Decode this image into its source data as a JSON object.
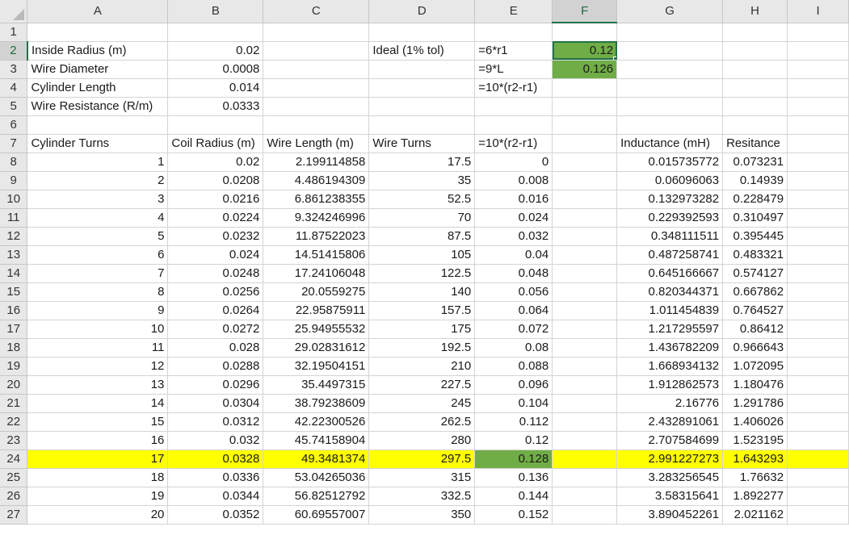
{
  "columns": [
    "A",
    "B",
    "C",
    "D",
    "E",
    "F",
    "G",
    "H",
    "I"
  ],
  "active_cell": "F2",
  "colors": {
    "highlight_row": "#ffff00",
    "green_fill": "#70ad47",
    "selection": "#217346",
    "header_bg": "#e8e8e8"
  },
  "rows": [
    {
      "n": "1",
      "A": "",
      "B": "",
      "C": "",
      "D": "",
      "E": "",
      "F": "",
      "G": "",
      "H": ""
    },
    {
      "n": "2",
      "A": "Inside Radius (m)",
      "B": "0.02",
      "C": "",
      "D": "Ideal (1% tol)",
      "E": "=6*r1",
      "F": "0.12",
      "G": "",
      "H": ""
    },
    {
      "n": "3",
      "A": "Wire Diameter",
      "B": "0.0008",
      "C": "",
      "D": "",
      "E": "=9*L",
      "F": "0.126",
      "G": "",
      "H": ""
    },
    {
      "n": "4",
      "A": "Cylinder Length",
      "B": "0.014",
      "C": "",
      "D": "",
      "E": "=10*(r2-r1)",
      "F": "",
      "G": "",
      "H": ""
    },
    {
      "n": "5",
      "A": "Wire Resistance (R/m)",
      "B": "0.0333",
      "C": "",
      "D": "",
      "E": "",
      "F": "",
      "G": "",
      "H": ""
    },
    {
      "n": "6",
      "A": "",
      "B": "",
      "C": "",
      "D": "",
      "E": "",
      "F": "",
      "G": "",
      "H": ""
    },
    {
      "n": "7",
      "A": "Cylinder Turns",
      "B": "Coil Radius (m)",
      "C": "Wire Length (m)",
      "D": "Wire Turns",
      "E": "=10*(r2-r1)",
      "F": "",
      "G": "Inductance (mH)",
      "H": "Resitance"
    },
    {
      "n": "8",
      "A": "1",
      "B": "0.02",
      "C": "2.199114858",
      "D": "17.5",
      "E": "0",
      "F": "",
      "G": "0.015735772",
      "H": "0.073231"
    },
    {
      "n": "9",
      "A": "2",
      "B": "0.0208",
      "C": "4.486194309",
      "D": "35",
      "E": "0.008",
      "F": "",
      "G": "0.06096063",
      "H": "0.14939"
    },
    {
      "n": "10",
      "A": "3",
      "B": "0.0216",
      "C": "6.861238355",
      "D": "52.5",
      "E": "0.016",
      "F": "",
      "G": "0.132973282",
      "H": "0.228479"
    },
    {
      "n": "11",
      "A": "4",
      "B": "0.0224",
      "C": "9.324246996",
      "D": "70",
      "E": "0.024",
      "F": "",
      "G": "0.229392593",
      "H": "0.310497"
    },
    {
      "n": "12",
      "A": "5",
      "B": "0.0232",
      "C": "11.87522023",
      "D": "87.5",
      "E": "0.032",
      "F": "",
      "G": "0.348111511",
      "H": "0.395445"
    },
    {
      "n": "13",
      "A": "6",
      "B": "0.024",
      "C": "14.51415806",
      "D": "105",
      "E": "0.04",
      "F": "",
      "G": "0.487258741",
      "H": "0.483321"
    },
    {
      "n": "14",
      "A": "7",
      "B": "0.0248",
      "C": "17.24106048",
      "D": "122.5",
      "E": "0.048",
      "F": "",
      "G": "0.645166667",
      "H": "0.574127"
    },
    {
      "n": "15",
      "A": "8",
      "B": "0.0256",
      "C": "20.0559275",
      "D": "140",
      "E": "0.056",
      "F": "",
      "G": "0.820344371",
      "H": "0.667862"
    },
    {
      "n": "16",
      "A": "9",
      "B": "0.0264",
      "C": "22.95875911",
      "D": "157.5",
      "E": "0.064",
      "F": "",
      "G": "1.011454839",
      "H": "0.764527"
    },
    {
      "n": "17",
      "A": "10",
      "B": "0.0272",
      "C": "25.94955532",
      "D": "175",
      "E": "0.072",
      "F": "",
      "G": "1.217295597",
      "H": "0.86412"
    },
    {
      "n": "18",
      "A": "11",
      "B": "0.028",
      "C": "29.02831612",
      "D": "192.5",
      "E": "0.08",
      "F": "",
      "G": "1.436782209",
      "H": "0.966643"
    },
    {
      "n": "19",
      "A": "12",
      "B": "0.0288",
      "C": "32.19504151",
      "D": "210",
      "E": "0.088",
      "F": "",
      "G": "1.668934132",
      "H": "1.072095"
    },
    {
      "n": "20",
      "A": "13",
      "B": "0.0296",
      "C": "35.4497315",
      "D": "227.5",
      "E": "0.096",
      "F": "",
      "G": "1.912862573",
      "H": "1.180476"
    },
    {
      "n": "21",
      "A": "14",
      "B": "0.0304",
      "C": "38.79238609",
      "D": "245",
      "E": "0.104",
      "F": "",
      "G": "2.16776",
      "H": "1.291786"
    },
    {
      "n": "22",
      "A": "15",
      "B": "0.0312",
      "C": "42.22300526",
      "D": "262.5",
      "E": "0.112",
      "F": "",
      "G": "2.432891061",
      "H": "1.406026"
    },
    {
      "n": "23",
      "A": "16",
      "B": "0.032",
      "C": "45.74158904",
      "D": "280",
      "E": "0.12",
      "F": "",
      "G": "2.707584699",
      "H": "1.523195"
    },
    {
      "n": "24",
      "A": "17",
      "B": "0.0328",
      "C": "49.3481374",
      "D": "297.5",
      "E": "0.128",
      "F": "",
      "G": "2.991227273",
      "H": "1.643293"
    },
    {
      "n": "25",
      "A": "18",
      "B": "0.0336",
      "C": "53.04265036",
      "D": "315",
      "E": "0.136",
      "F": "",
      "G": "3.283256545",
      "H": "1.76632"
    },
    {
      "n": "26",
      "A": "19",
      "B": "0.0344",
      "C": "56.82512792",
      "D": "332.5",
      "E": "0.144",
      "F": "",
      "G": "3.58315641",
      "H": "1.892277"
    },
    {
      "n": "27",
      "A": "20",
      "B": "0.0352",
      "C": "60.69557007",
      "D": "350",
      "E": "0.152",
      "F": "",
      "G": "3.890452261",
      "H": "2.021162"
    }
  ]
}
